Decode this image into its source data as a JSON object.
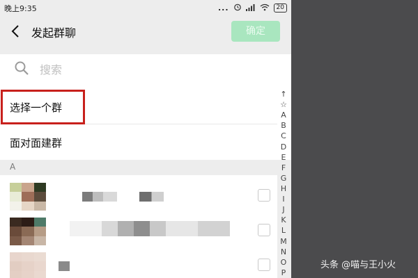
{
  "status_bar": {
    "time": "晚上9:35",
    "icons": [
      "more-icon",
      "alarm-icon",
      "signal-icon",
      "wifi-icon",
      "battery-icon"
    ],
    "dots": "...",
    "battery": "20"
  },
  "header": {
    "back_icon": "chevron-left-icon",
    "title": "发起群聊",
    "confirm_label": "确定",
    "confirm_color": "#a9e6bf"
  },
  "search": {
    "icon": "search-icon",
    "placeholder": "搜索"
  },
  "options": {
    "select_group": "选择一个群",
    "face_to_face": "面对面建群",
    "highlight_color": "#c8201c"
  },
  "section": {
    "header": "A"
  },
  "contacts": [
    {
      "avatar_colors": [
        "#c7cf9a",
        "#c9a48c",
        "#2e3a22",
        "#e9ecd7",
        "#9e6e58",
        "#5c4c3c",
        "#f3f2ea",
        "#e6d6c6",
        "#c9b8a6"
      ]
    },
    {
      "avatar_colors": [
        "#3a2a20",
        "#2c1c16",
        "#4e7a68",
        "#6a4b3a",
        "#8a6a55",
        "#b69c86",
        "#7a5a48",
        "#a48674",
        "#c8b6a6"
      ]
    },
    {
      "avatar_colors": [
        "#e8d5cc",
        "#e9d8cf",
        "#eadbd2",
        "#e2cdc2",
        "#e6d2c8",
        "#e9d7ce",
        "#e4cfc4",
        "#e7d3c9",
        "#ead9d0"
      ]
    }
  ],
  "index_bar": [
    "↑",
    "☆",
    "A",
    "B",
    "C",
    "D",
    "E",
    "F",
    "G",
    "H",
    "I",
    "J",
    "K",
    "L",
    "M",
    "N",
    "O",
    "P"
  ],
  "watermark": "头条 @喵与王小火"
}
